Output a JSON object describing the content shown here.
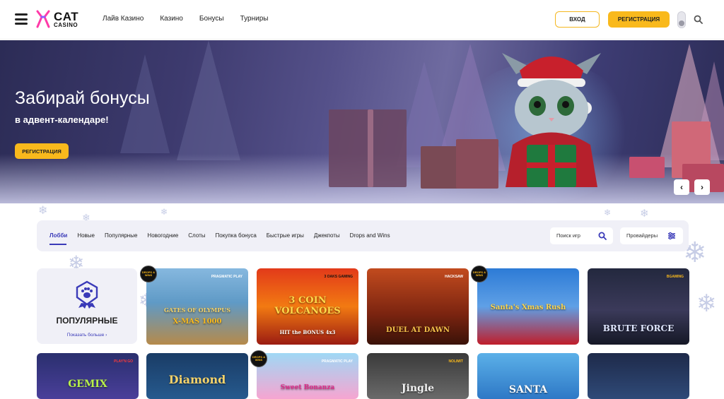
{
  "header": {
    "logo_line1": "CAT",
    "logo_line2": "CASINO",
    "nav": [
      "Лайв Казино",
      "Казино",
      "Бонусы",
      "Турниры"
    ],
    "login_label": "ВХОД",
    "register_label": "РЕГИСТРАЦИЯ"
  },
  "hero": {
    "title": "Забирай бонусы",
    "subtitle": "в адвент-календаре!",
    "button_label": "РЕГИСТРАЦИЯ",
    "prev_arrow": "‹",
    "next_arrow": "›"
  },
  "lobby": {
    "tabs": [
      "Лобби",
      "Новые",
      "Популярные",
      "Новогодние",
      "Слоты",
      "Покупка бонуса",
      "Быстрые игры",
      "Джекпоты",
      "Drops and Wins"
    ],
    "active_tab": "Лобби",
    "search_placeholder": "Поиск игр",
    "providers_label": "Провайдеры"
  },
  "popular": {
    "title": "ПОПУЛЯРНЫЕ",
    "more_label": "Показать больше ›"
  },
  "games_row1": [
    {
      "title": "GATES OF OLYMPUS",
      "subtitle": "X-MAS 1000",
      "provider": "PRAGMATIC PLAY"
    },
    {
      "title": "3 COIN VOLCANOES",
      "subtitle": "HIT the BONUS 4x3",
      "provider": "3 OAKS GAMING"
    },
    {
      "title": "DUEL AT DAWN",
      "subtitle": "",
      "provider": "HACKSAW"
    },
    {
      "title": "Santa's Xmas Rush",
      "subtitle": "",
      "provider": ""
    },
    {
      "title": "BRUTE FORCE",
      "subtitle": "",
      "provider": "BGAMING"
    }
  ],
  "games_row2": [
    {
      "title": "GEMIX",
      "provider": "PLAY'N GO"
    },
    {
      "title": "Diamond",
      "provider": ""
    },
    {
      "title": "Sweet Bonanza",
      "provider": "PRAGMATIC PLAY"
    },
    {
      "title": "Jingle",
      "provider": "NOLIMIT"
    },
    {
      "title": "SANTA",
      "provider": ""
    },
    {
      "title": "",
      "provider": ""
    }
  ],
  "badges": {
    "drops_wins": "DROPS & WINS"
  },
  "colors": {
    "accent_yellow": "#f9b91c",
    "accent_purple": "#3a3ab8",
    "tabs_bg": "#f0f0f7"
  }
}
